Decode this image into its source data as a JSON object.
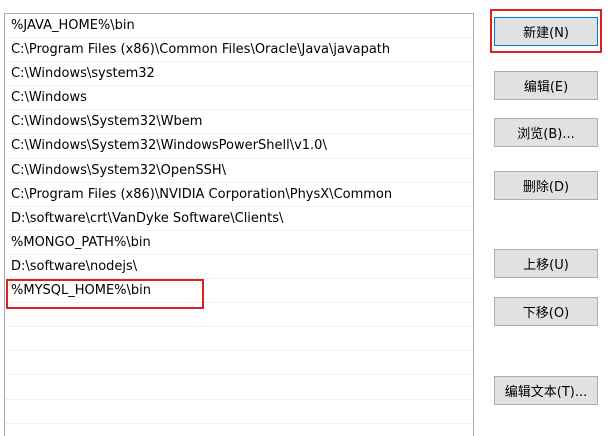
{
  "paths": [
    "%JAVA_HOME%\\bin",
    "C:\\Program Files (x86)\\Common Files\\Oracle\\Java\\javapath",
    "C:\\Windows\\system32",
    "C:\\Windows",
    "C:\\Windows\\System32\\Wbem",
    "C:\\Windows\\System32\\WindowsPowerShell\\v1.0\\",
    "C:\\Windows\\System32\\OpenSSH\\",
    "C:\\Program Files (x86)\\NVIDIA Corporation\\PhysX\\Common",
    "D:\\software\\crt\\VanDyke Software\\Clients\\",
    "%MONGO_PATH%\\bin",
    "D:\\software\\nodejs\\",
    "%MYSQL_HOME%\\bin",
    "",
    "",
    "",
    "",
    "",
    ""
  ],
  "buttons": {
    "new": "新建(N)",
    "edit": "编辑(E)",
    "browse": "浏览(B)...",
    "delete": "删除(D)",
    "move_up": "上移(U)",
    "move_down": "下移(O)",
    "edit_text": "编辑文本(T)..."
  },
  "colors": {
    "highlight": "#e0201f",
    "button_bg": "#e1e1e1",
    "border": "#adadad"
  }
}
